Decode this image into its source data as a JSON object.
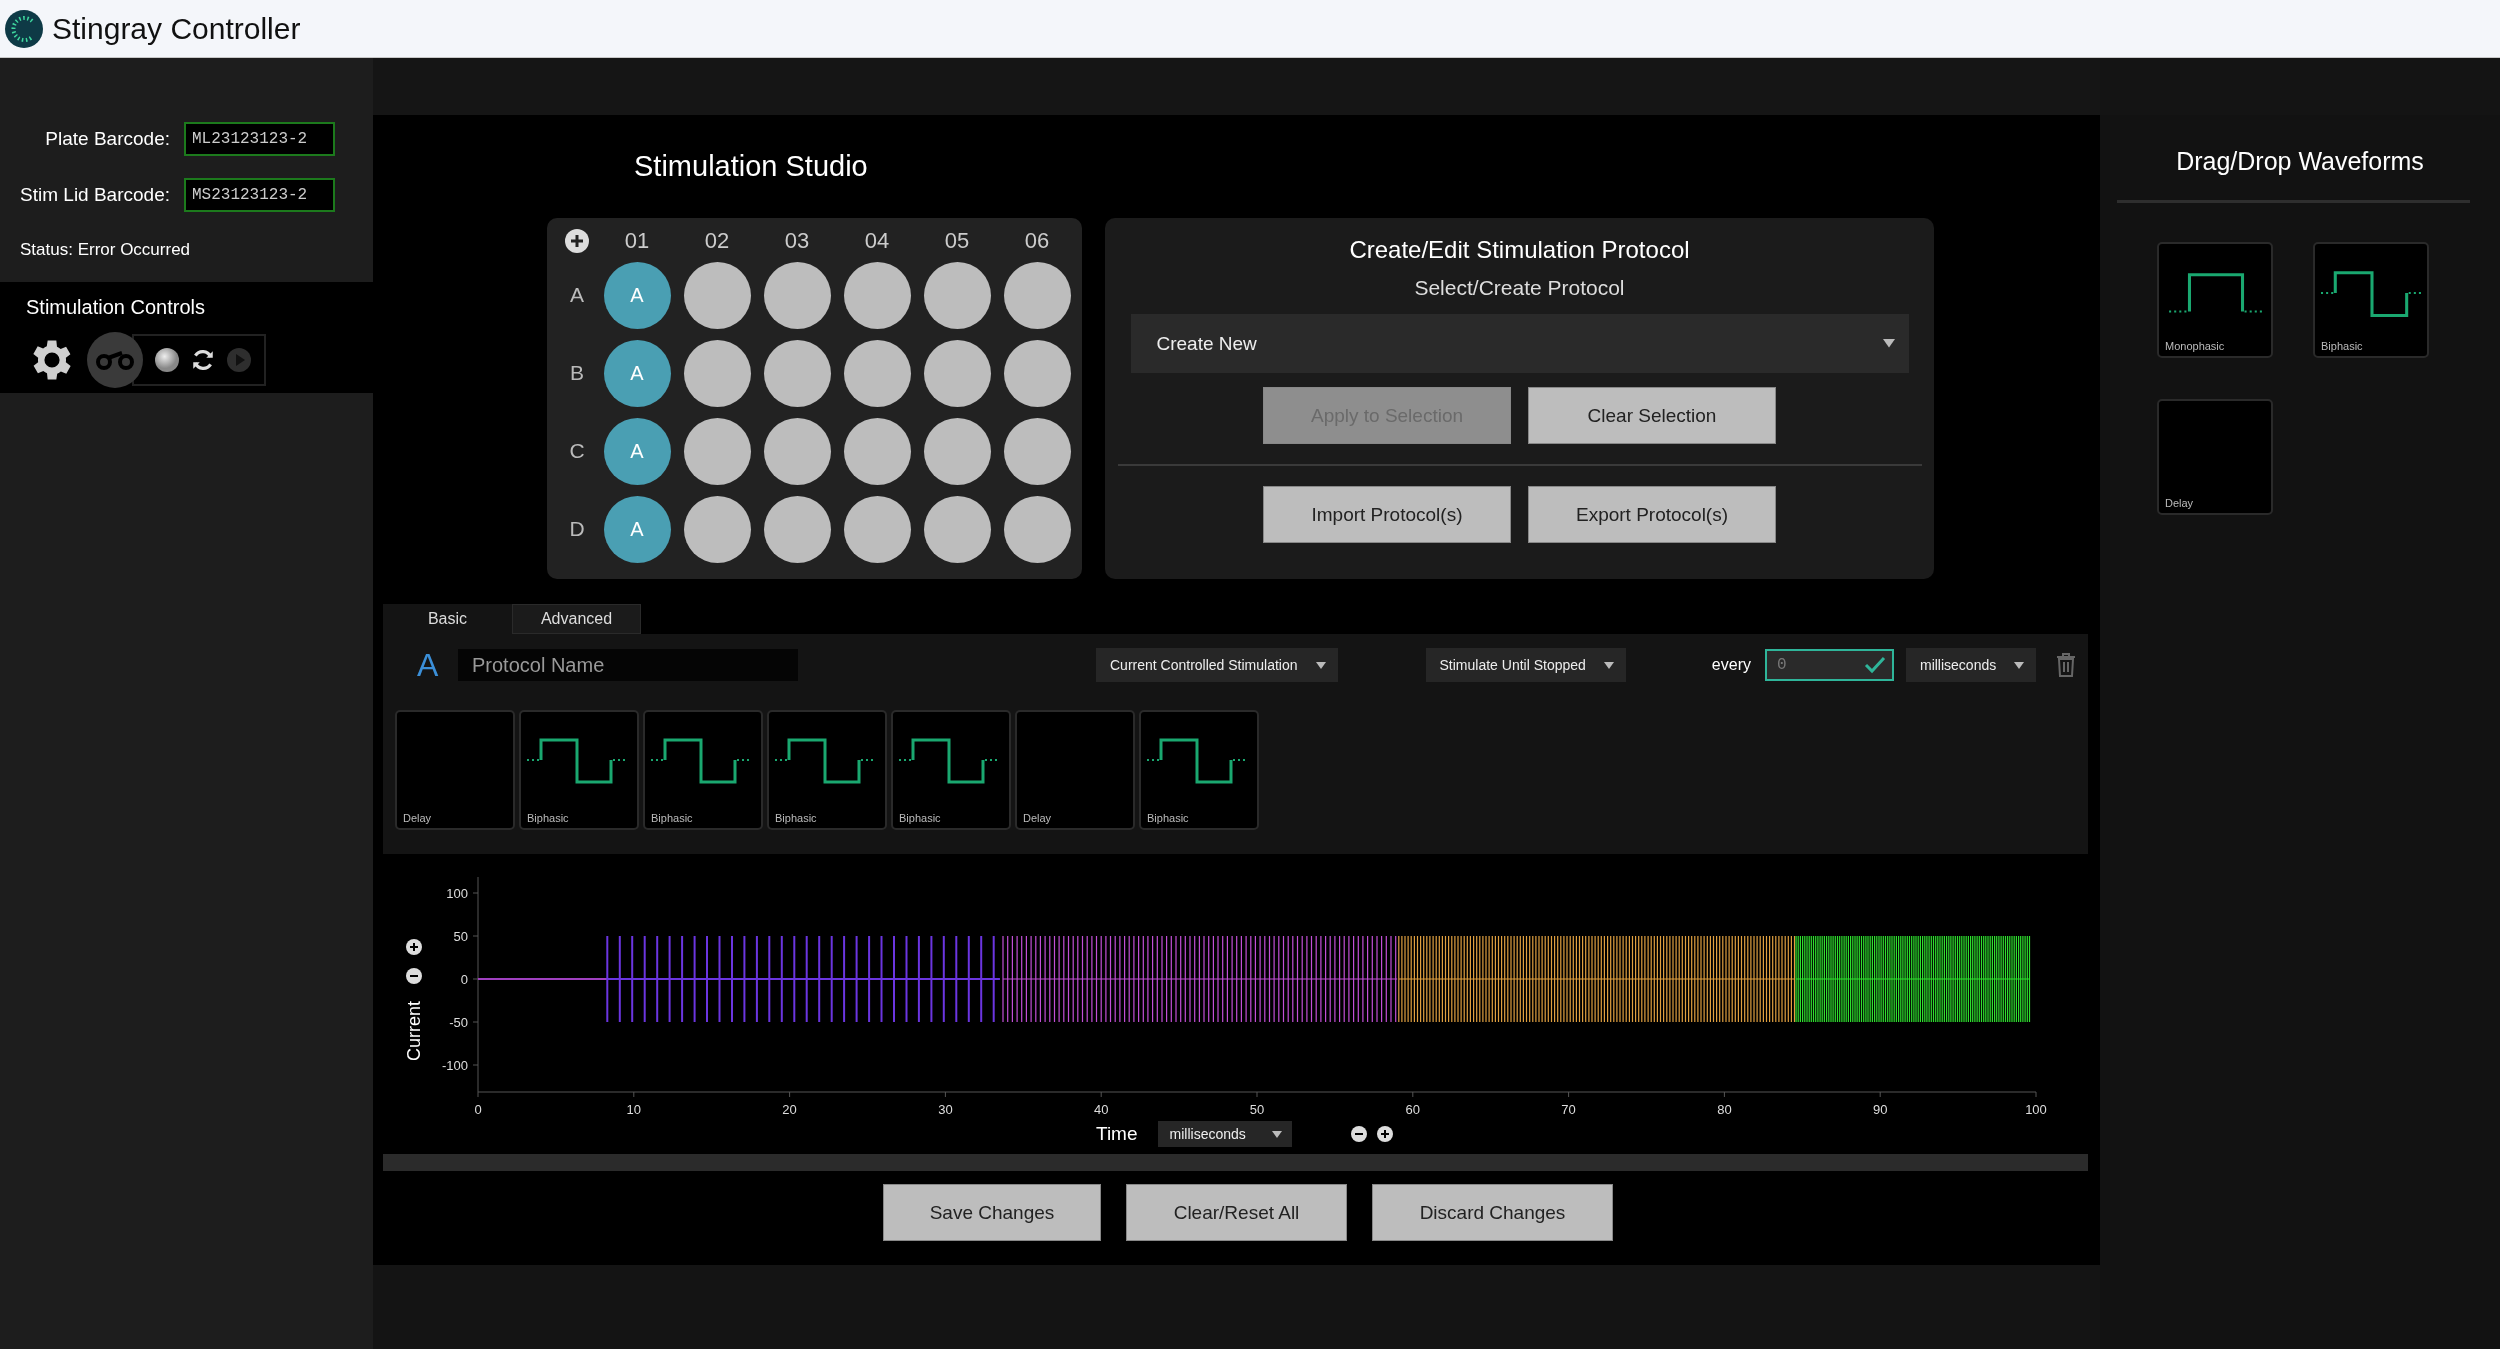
{
  "window": {
    "title": "Stingray Controller"
  },
  "sidebar": {
    "barcodes": [
      {
        "label": "Plate Barcode:",
        "value": "ML23123123-2"
      },
      {
        "label": "Stim Lid Barcode:",
        "value": "MS23123123-2"
      }
    ],
    "status": "Status: Error Occurred",
    "controls_title": "Stimulation Controls"
  },
  "studio": {
    "title": "Stimulation Studio"
  },
  "plate": {
    "columns": [
      "01",
      "02",
      "03",
      "04",
      "05",
      "06"
    ],
    "rows": [
      {
        "label": "A",
        "wells": [
          {
            "selected": true,
            "protocol": "A"
          },
          {
            "selected": false
          },
          {
            "selected": false
          },
          {
            "selected": false
          },
          {
            "selected": false
          },
          {
            "selected": false
          }
        ]
      },
      {
        "label": "B",
        "wells": [
          {
            "selected": true,
            "protocol": "A"
          },
          {
            "selected": false
          },
          {
            "selected": false
          },
          {
            "selected": false
          },
          {
            "selected": false
          },
          {
            "selected": false
          }
        ]
      },
      {
        "label": "C",
        "wells": [
          {
            "selected": true,
            "protocol": "A"
          },
          {
            "selected": false
          },
          {
            "selected": false
          },
          {
            "selected": false
          },
          {
            "selected": false
          },
          {
            "selected": false
          }
        ]
      },
      {
        "label": "D",
        "wells": [
          {
            "selected": true,
            "protocol": "A"
          },
          {
            "selected": false
          },
          {
            "selected": false
          },
          {
            "selected": false
          },
          {
            "selected": false
          },
          {
            "selected": false
          }
        ]
      }
    ]
  },
  "protocol_panel": {
    "title": "Create/Edit Stimulation Protocol",
    "subtitle": "Select/Create Protocol",
    "dropdown": {
      "value": "Create New"
    },
    "buttons": [
      {
        "label": "Apply to Selection",
        "disabled": true
      },
      {
        "label": "Clear Selection",
        "disabled": false
      },
      {
        "label": "Import Protocol(s)",
        "disabled": false
      },
      {
        "label": "Export Protocol(s)",
        "disabled": false
      }
    ]
  },
  "editor": {
    "tabs": [
      {
        "label": "Basic",
        "selected": true
      },
      {
        "label": "Advanced",
        "selected": false
      }
    ],
    "protocol_letter": "A",
    "name_field": {
      "placeholder": "Protocol Name"
    },
    "stimulation_type": "Current Controlled Stimulation",
    "run_mode": "Stimulate Until Stopped",
    "every_label": "every",
    "interval": {
      "placeholder": "0"
    },
    "interval_unit": "milliseconds",
    "blocks": [
      {
        "kind": "delay",
        "label": "Delay"
      },
      {
        "kind": "biphasic",
        "label": "Biphasic"
      },
      {
        "kind": "biphasic",
        "label": "Biphasic"
      },
      {
        "kind": "biphasic",
        "label": "Biphasic"
      },
      {
        "kind": "biphasic",
        "label": "Biphasic"
      },
      {
        "kind": "delay",
        "label": "Delay"
      },
      {
        "kind": "biphasic",
        "label": "Biphasic"
      }
    ]
  },
  "waveform_chart": {
    "ylabel": "Current",
    "xlabel": "Time",
    "yticks": [
      "100",
      "50",
      "0",
      "-50",
      "-100"
    ],
    "xticks": [
      "0",
      "10",
      "20",
      "30",
      "40",
      "50",
      "60",
      "70",
      "80",
      "90",
      "100"
    ],
    "unit": "milliseconds"
  },
  "footer_buttons": [
    "Save Changes",
    "Clear/Reset All",
    "Discard Changes"
  ],
  "palette": {
    "title": "Drag/Drop Waveforms",
    "items": [
      {
        "kind": "monophasic",
        "label": "Monophasic"
      },
      {
        "kind": "biphasic",
        "label": "Biphasic"
      },
      {
        "kind": "delay",
        "label": "Delay"
      }
    ]
  }
}
